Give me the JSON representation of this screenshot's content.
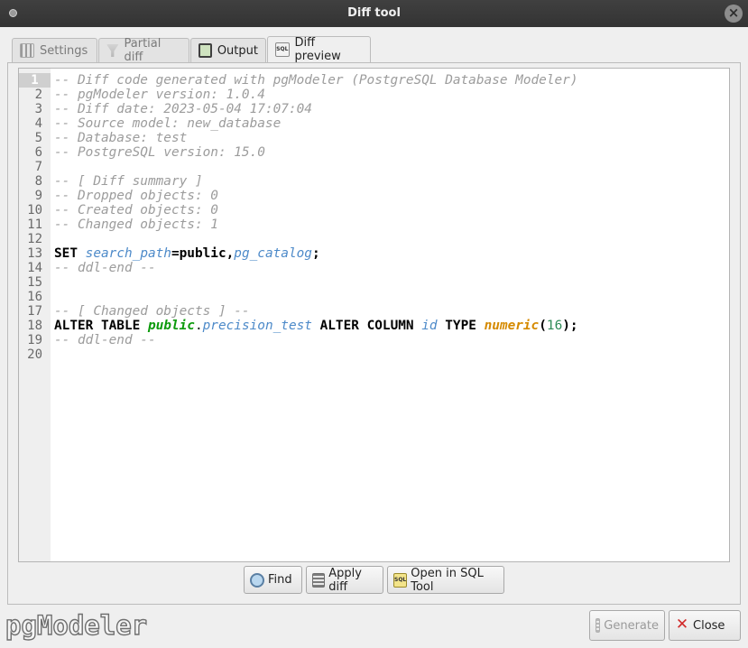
{
  "window": {
    "title": "Diff tool"
  },
  "tabs": [
    {
      "label": "Settings",
      "icon": "settings-icon"
    },
    {
      "label": "Partial diff",
      "icon": "filter-icon"
    },
    {
      "label": "Output",
      "icon": "output-icon"
    },
    {
      "label": "Diff preview",
      "icon": "sql-icon",
      "active": true
    }
  ],
  "editor": {
    "line_numbers": [
      "1",
      "2",
      "3",
      "4",
      "5",
      "6",
      "7",
      "8",
      "9",
      "10",
      "11",
      "12",
      "13",
      "14",
      "15",
      "16",
      "17",
      "18",
      "19",
      "20"
    ],
    "current_line": 1,
    "lines": [
      "-- Diff code generated with pgModeler (PostgreSQL Database Modeler)",
      "-- pgModeler version: 1.0.4",
      "-- Diff date: 2023-05-04 17:07:04",
      "-- Source model: new_database",
      "-- Database: test",
      "-- PostgreSQL version: 15.0",
      "",
      "-- [ Diff summary ]",
      "-- Dropped objects: 0",
      "-- Created objects: 0",
      "-- Changed objects: 1",
      "",
      "SET search_path=public,pg_catalog;",
      "-- ddl-end --",
      "",
      "",
      "-- [ Changed objects ] --",
      "ALTER TABLE public.precision_test ALTER COLUMN id TYPE numeric(16);",
      "-- ddl-end --",
      ""
    ]
  },
  "buttons": {
    "find": "Find",
    "apply_diff": "Apply diff",
    "open_sql_tool": "Open in SQL Tool",
    "generate": "Generate",
    "close": "Close"
  },
  "branding": {
    "logo_text": "pgModeler"
  },
  "colors": {
    "comment": "#9c9c9c",
    "identifier": "#4d8ac9",
    "schema": "#0b9a0b",
    "type": "#d58a00",
    "titlebar": "#383838"
  }
}
